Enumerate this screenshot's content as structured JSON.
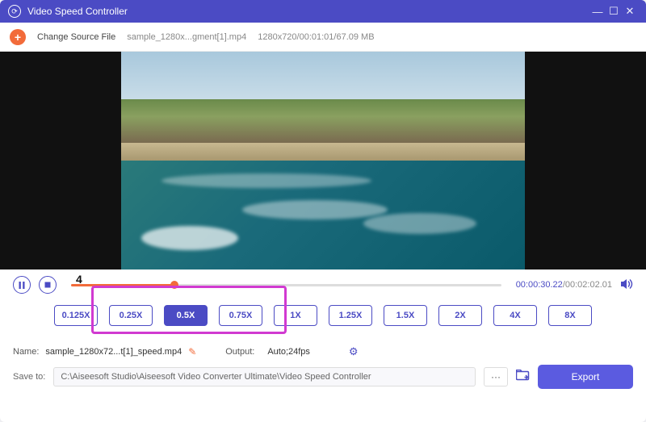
{
  "window": {
    "title": "Video Speed Controller"
  },
  "toolbar": {
    "changeSource": "Change Source File",
    "filename": "sample_1280x...gment[1].mp4",
    "fileinfo": "1280x720/00:01:01/67.09 MB"
  },
  "playback": {
    "current": "00:00:30.22",
    "total": "00:02:02.01"
  },
  "annotation": {
    "number": "4"
  },
  "speeds": [
    "0.125X",
    "0.25X",
    "0.5X",
    "0.75X",
    "1X",
    "1.25X",
    "1.5X",
    "2X",
    "4X",
    "8X"
  ],
  "activeSpeedIndex": 2,
  "name": {
    "label": "Name:",
    "value": "sample_1280x72...t[1]_speed.mp4"
  },
  "output": {
    "label": "Output:",
    "value": "Auto;24fps"
  },
  "saveTo": {
    "label": "Save to:",
    "path": "C:\\Aiseesoft Studio\\Aiseesoft Video Converter Ultimate\\Video Speed Controller"
  },
  "export": {
    "label": "Export"
  }
}
